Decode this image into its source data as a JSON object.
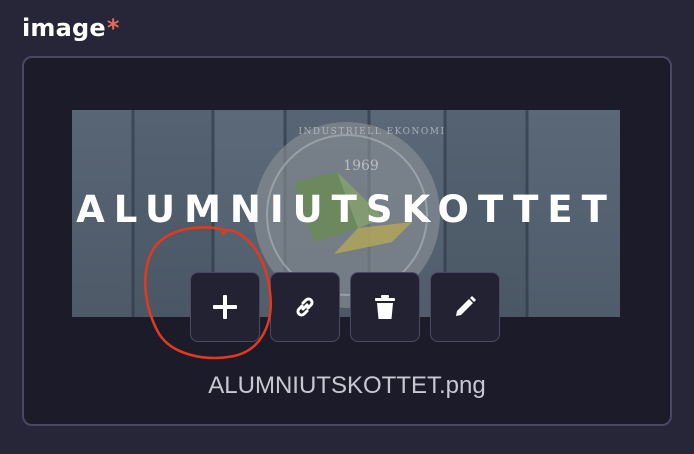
{
  "field": {
    "label": "image",
    "required_marker": "*"
  },
  "preview": {
    "banner_text": "ALUMNIUTSKOTTET",
    "seal_year": "1969",
    "seal_text": "INDUSTRIELL EKONOMI"
  },
  "actions": [
    {
      "name": "add",
      "icon": "plus-icon"
    },
    {
      "name": "link",
      "icon": "link-icon"
    },
    {
      "name": "delete",
      "icon": "trash-icon"
    },
    {
      "name": "edit",
      "icon": "pencil-icon"
    }
  ],
  "file": {
    "name": "ALUMNIUTSKOTTET.png"
  },
  "colors": {
    "background": "#272638",
    "dropzone": "#1c1b29",
    "required": "#e36b5a",
    "annotation": "#e33a1f"
  }
}
